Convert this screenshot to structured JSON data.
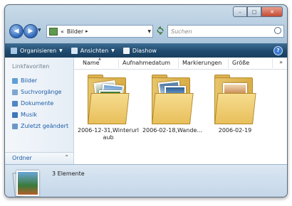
{
  "window": {
    "minimize_glyph": "–",
    "maximize_glyph": "□",
    "close_glyph": "✕"
  },
  "nav": {
    "back_glyph": "◀",
    "forward_glyph": "▶",
    "history_glyph": "▼"
  },
  "address": {
    "prefix": "«",
    "location": "Bilder",
    "chevron": "▸",
    "dropdown_glyph": "▼"
  },
  "search": {
    "placeholder": "Suchen"
  },
  "toolbar": {
    "items": [
      {
        "label": "Organisieren",
        "has_menu": true,
        "icon": "organize-icon"
      },
      {
        "label": "Ansichten",
        "has_menu": true,
        "icon": "views-icon"
      },
      {
        "label": "Diashow",
        "has_menu": false,
        "icon": "slideshow-icon"
      }
    ],
    "help_glyph": "?"
  },
  "sidebar": {
    "heading": "Linkfavoriten",
    "items": [
      {
        "label": "Bilder",
        "icon": "pictures-icon"
      },
      {
        "label": "Suchvorgänge",
        "icon": "searches-icon"
      },
      {
        "label": "Dokumente",
        "icon": "documents-icon"
      },
      {
        "label": "Musik",
        "icon": "music-icon"
      },
      {
        "label": "Zuletzt geändert",
        "icon": "recent-icon"
      }
    ],
    "folders_label": "Ordner",
    "folders_chevron": "⌃"
  },
  "columns": [
    "Name",
    "Aufnahmedatum",
    "Markierungen",
    "Größe"
  ],
  "columns_more": "»",
  "files": [
    {
      "name": "2006-12-31,Winterurlaub",
      "line1": "2006-12-31,Winterurl",
      "line2": "aub"
    },
    {
      "name": "2006-02-18,Wande...",
      "line1": "2006-02-18,Wande...",
      "line2": ""
    },
    {
      "name": "2006-02-19",
      "line1": "2006-02-19",
      "line2": ""
    }
  ],
  "details": {
    "count_text": "3 Elemente"
  },
  "colors": {
    "toolbar": "#1f4a6e",
    "link": "#1d5da8",
    "folder": "#e7c46b"
  }
}
